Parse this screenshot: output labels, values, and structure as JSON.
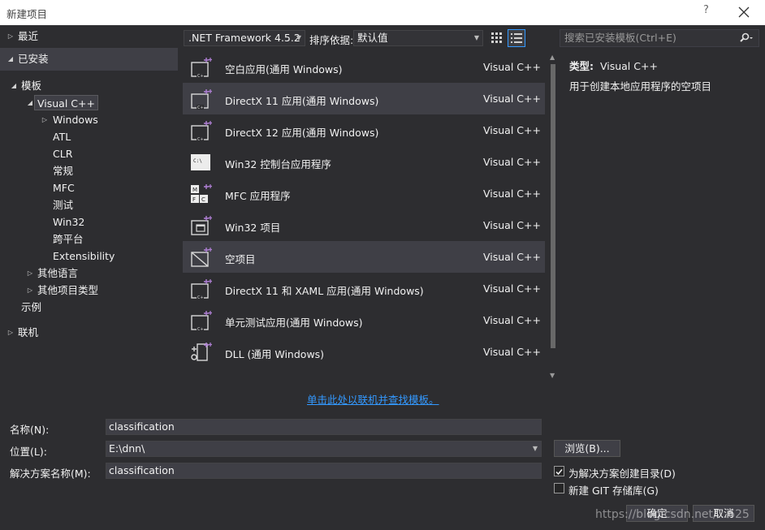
{
  "window": {
    "title": "新建项目",
    "help": "?"
  },
  "tree": [
    {
      "label": "最近",
      "expander": "collapsed",
      "level": 0
    },
    {
      "label": "已安装",
      "expander": "expanded",
      "level": 0,
      "selected": true
    },
    {
      "label": "模板",
      "expander": "expanded",
      "level": 1
    },
    {
      "label": "Visual C++",
      "expander": "expanded",
      "level": 2,
      "highlighted": true
    },
    {
      "label": "Windows",
      "expander": "collapsed",
      "level": 3
    },
    {
      "label": "ATL",
      "expander": "none",
      "level": 3
    },
    {
      "label": "CLR",
      "expander": "none",
      "level": 3
    },
    {
      "label": "常规",
      "expander": "none",
      "level": 3
    },
    {
      "label": "MFC",
      "expander": "none",
      "level": 3
    },
    {
      "label": "测试",
      "expander": "none",
      "level": 3
    },
    {
      "label": "Win32",
      "expander": "none",
      "level": 3
    },
    {
      "label": "跨平台",
      "expander": "none",
      "level": 3
    },
    {
      "label": "Extensibility",
      "expander": "none",
      "level": 3
    },
    {
      "label": "其他语言",
      "expander": "collapsed",
      "level": 2
    },
    {
      "label": "其他项目类型",
      "expander": "collapsed",
      "level": 2
    },
    {
      "label": "示例",
      "expander": "none",
      "level": 1
    },
    {
      "label": "联机",
      "expander": "collapsed",
      "level": 0
    }
  ],
  "toolbar": {
    "framework": ".NET Framework 4.5.2",
    "sort_label": "排序依据:",
    "sort_value": "默认值",
    "search_placeholder": "搜索已安装模板(Ctrl+E)"
  },
  "templates": [
    {
      "name": "空白应用(通用 Windows)",
      "lang": "Visual C++",
      "icon": "blank-app-icon"
    },
    {
      "name": "DirectX 11 应用(通用 Windows)",
      "lang": "Visual C++",
      "icon": "directx-app-icon",
      "selected": true
    },
    {
      "name": "DirectX 12 应用(通用 Windows)",
      "lang": "Visual C++",
      "icon": "directx-app-icon"
    },
    {
      "name": "Win32 控制台应用程序",
      "lang": "Visual C++",
      "icon": "console-app-icon"
    },
    {
      "name": "MFC 应用程序",
      "lang": "Visual C++",
      "icon": "mfc-app-icon"
    },
    {
      "name": "Win32 项目",
      "lang": "Visual C++",
      "icon": "win32-project-icon"
    },
    {
      "name": "空项目",
      "lang": "Visual C++",
      "icon": "empty-project-icon",
      "selected": true
    },
    {
      "name": "DirectX 11 和 XAML 应用(通用 Windows)",
      "lang": "Visual C++",
      "icon": "directx-xaml-app-icon"
    },
    {
      "name": "单元测试应用(通用 Windows)",
      "lang": "Visual C++",
      "icon": "unit-test-app-icon"
    },
    {
      "name": "DLL (通用 Windows)",
      "lang": "Visual C++",
      "icon": "dll-icon"
    }
  ],
  "detail": {
    "type_label": "类型:",
    "type_value": "Visual C++",
    "description": "用于创建本地应用程序的空项目"
  },
  "online_link": "单击此处以联机并查找模板。",
  "form": {
    "name_label": "名称(N):",
    "name_value": "classification",
    "location_label": "位置(L):",
    "location_value": "E:\\dnn\\",
    "solution_label": "解决方案名称(M):",
    "solution_value": "classification",
    "browse": "浏览(B)...",
    "create_dir": "为解决方案创建目录(D)",
    "create_dir_checked": true,
    "git": "新建 GIT 存储库(G)",
    "git_checked": false,
    "ok": "确定",
    "cancel": "取消"
  },
  "watermark": "https://blog.csdn.net/...625",
  "colors": {
    "accent": "#3399ff",
    "background": "#2d2d30",
    "selection": "#3f3f46",
    "titlebar": "#ffffff"
  }
}
